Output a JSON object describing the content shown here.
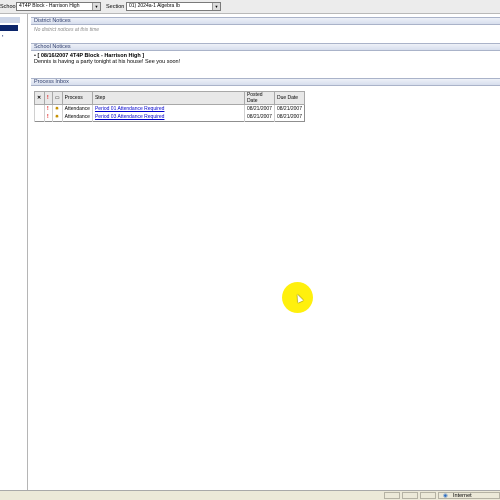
{
  "toolbar": {
    "school_label": "School",
    "school_value": "4T4P Block - Harrison High",
    "section_label": "Section",
    "section_value": "01) 2024a-1 Algebra Ib"
  },
  "district_notices": {
    "title": "District Notices",
    "empty_text": "No district notices at this time"
  },
  "school_notices": {
    "title": "School Notices",
    "headline": "[ 08/16/2007 4T4P Block - Harrison High ]",
    "message": "Dennis is having a party tonight at his house!  See you soon!"
  },
  "process_inbox": {
    "title": "Process Inbox",
    "columns": {
      "process": "Process",
      "step": "Step",
      "posted_date": "Posted Date",
      "due_date": "Due Date"
    },
    "rows": [
      {
        "process": "Attendance",
        "step": "Period 01 Attendance Required",
        "posted_date": "08/21/2007",
        "due_date": "08/21/2007"
      },
      {
        "process": "Attendance",
        "step": "Period 03 Attendance Required",
        "posted_date": "08/21/2007",
        "due_date": "08/21/2007"
      }
    ]
  },
  "statusbar": {
    "zone": "Internet"
  },
  "icons": {
    "delete": "close-icon",
    "priority": "exclamation-icon",
    "page": "page-icon",
    "new": "star-icon"
  },
  "colors": {
    "nav_active": "#0a246a",
    "link": "#0000cc",
    "cursor_highlight": "#ffef00"
  }
}
